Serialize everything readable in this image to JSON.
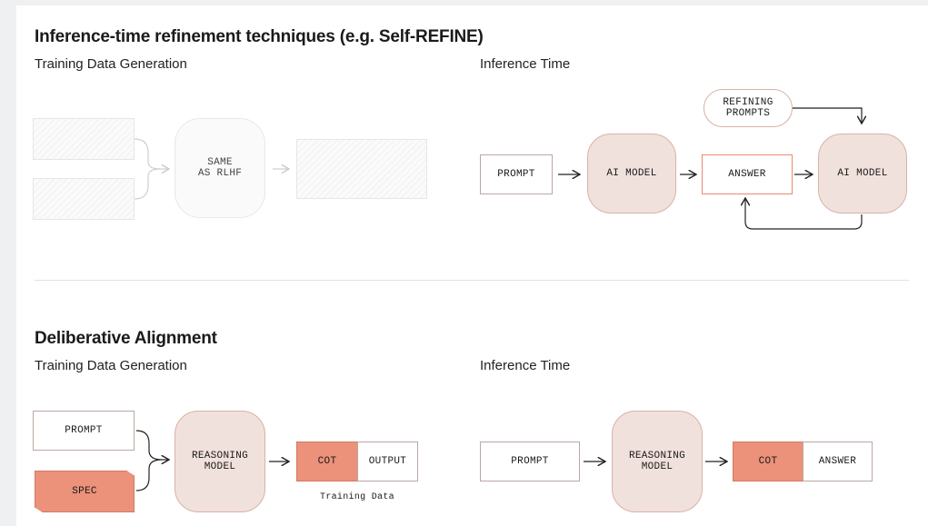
{
  "section1": {
    "title": "Inference-time refinement techniques (e.g. Self-REFINE)",
    "training_label": "Training Data Generation",
    "inference_label": "Inference Time",
    "training": {
      "model_label": "SAME\nAS RLHF"
    },
    "inference": {
      "prompt": "PROMPT",
      "model1": "AI MODEL",
      "answer": "ANSWER",
      "model2": "AI MODEL",
      "refining": "REFINING\nPROMPTS"
    }
  },
  "section2": {
    "title": "Deliberative Alignment",
    "training_label": "Training Data Generation",
    "inference_label": "Inference Time",
    "training": {
      "prompt": "PROMPT",
      "spec": "SPEC",
      "model": "REASONING\nMODEL",
      "cot": "COT",
      "output": "OUTPUT",
      "caption": "Training Data"
    },
    "inference": {
      "prompt": "PROMPT",
      "model": "REASONING\nMODEL",
      "cot": "COT",
      "answer": "ANSWER"
    }
  },
  "colors": {
    "accent": "#ea8a6f",
    "model_fill": "#f1e1dc",
    "cot_fill": "#ec917a"
  }
}
